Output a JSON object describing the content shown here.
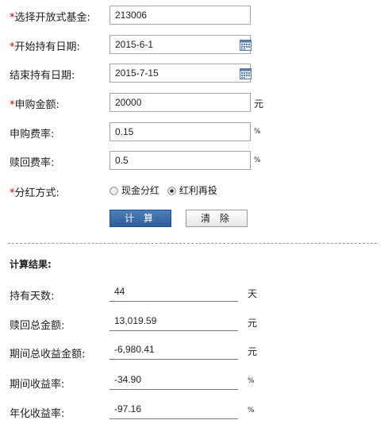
{
  "form": {
    "fund": {
      "label": "选择开放式基金:",
      "value": "213006",
      "required_mark": "*"
    },
    "start_date": {
      "label": "开始持有日期:",
      "value": "2015-6-1",
      "required_mark": "*"
    },
    "end_date": {
      "label": "结束持有日期:",
      "value": "2015-7-15"
    },
    "purchase_amount": {
      "label": "申购金额:",
      "value": "20000",
      "unit": "元",
      "required_mark": "*"
    },
    "purchase_fee": {
      "label": "申购费率:",
      "value": "0.15",
      "unit": "%"
    },
    "redeem_fee": {
      "label": "赎回费率:",
      "value": "0.5",
      "unit": "%"
    },
    "dividend": {
      "label": "分红方式:",
      "required_mark": "*",
      "options": [
        {
          "label": "现金分红",
          "checked": false
        },
        {
          "label": "红利再投",
          "checked": true
        }
      ]
    },
    "calc_button": "计 算",
    "clear_button": "清 除"
  },
  "results": {
    "title": "计算结果:",
    "rows": [
      {
        "label": "持有天数:",
        "value": "44",
        "unit": "天"
      },
      {
        "label": "赎回总金额:",
        "value": "13,019.59",
        "unit": "元"
      },
      {
        "label": "期间总收益金额:",
        "value": "-6,980.41",
        "unit": "元"
      },
      {
        "label": "期间收益率:",
        "value": "-34.90",
        "unit": "%"
      },
      {
        "label": "年化收益率:",
        "value": "-97.16",
        "unit": "%"
      }
    ]
  },
  "icons": {
    "calendar": "calendar-icon",
    "radio": "radio-icon"
  },
  "colors": {
    "required": "#cc0000",
    "primary_button": "#2d5d99",
    "border": "#a6a6a6"
  }
}
